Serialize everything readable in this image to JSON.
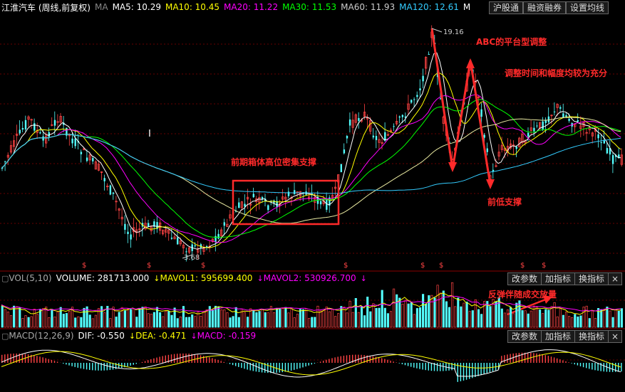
{
  "header": {
    "stock_title": "江淮汽车 (周线,前复权)",
    "ma_label": "MA",
    "ma5": "MA5: 10.29",
    "ma10": "MA10: 10.45",
    "ma20": "MA20: 11.22",
    "ma30": "MA30: 11.53",
    "ma60": "MA60: 11.93",
    "ma120": "MA120: 12.61",
    "m_cut": "M",
    "btn_hgt": "沪股通",
    "btn_margin": "融资融券",
    "btn_set_ma": "设置均线"
  },
  "colors": {
    "ma5": "#ffffff",
    "ma10": "#ffff00",
    "ma20": "#ff00ff",
    "ma30": "#00ff00",
    "ma60": "#cccccc",
    "ma120": "#33ccff",
    "up": "#ff4444",
    "down": "#54ffff",
    "annotation": "#ff2a2a",
    "grid": "#8b0000"
  },
  "price_panel": {
    "high_label": "19.16",
    "low_label": "3.68",
    "special_marker": "I",
    "s_marker": "$"
  },
  "annotations": {
    "abc": "ABC的平台型调整",
    "adjust": "调整时间和幅度均较为充分",
    "box": "前期箱体高位密集支撑",
    "low_support": "前低支撑",
    "volume": "反弹伴随成交放量"
  },
  "vol_panel": {
    "title": "VOL(5,10)",
    "volume": "VOLUME: 281713.000",
    "mavol1": "MAVOL1: 595699.400",
    "mavol2": "MAVOL2: 530926.700",
    "btn_params": "改参数",
    "btn_add": "加指标",
    "btn_switch": "换指标",
    "btn_close": "×"
  },
  "macd_panel": {
    "title": "MACD(12,26,9)",
    "dif": "DIF: -0.550",
    "dea": "DEA: -0.471",
    "macd": "MACD: -0.159",
    "btn_params": "改参数",
    "btn_add": "加指标",
    "btn_switch": "换指标",
    "btn_close": "×"
  }
}
